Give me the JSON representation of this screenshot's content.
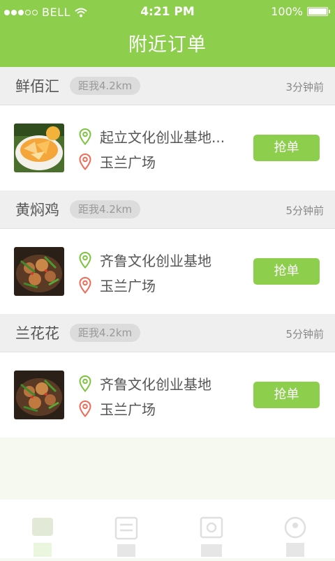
{
  "status_bar": {
    "carrier": "BELL",
    "time": "4:21 PM",
    "battery": "100%"
  },
  "header": {
    "title": "附近订单"
  },
  "orders": [
    {
      "shop": "鲜佰汇",
      "distance": "距我4.2km",
      "time_ago": "3分钟前",
      "from": "起立文化创业基地...",
      "to": "玉兰广场",
      "button": "抢单",
      "thumb": "orange-dessert"
    },
    {
      "shop": "黄焖鸡",
      "distance": "距我4.2km",
      "time_ago": "5分钟前",
      "from": "齐鲁文化创业基地",
      "to": "玉兰广场",
      "button": "抢单",
      "thumb": "braised-chicken"
    },
    {
      "shop": "兰花花",
      "distance": "距我4.2km",
      "time_ago": "5分钟前",
      "from": "齐鲁文化创业基地",
      "to": "玉兰广场",
      "button": "抢单",
      "thumb": "braised-chicken"
    }
  ],
  "colors": {
    "accent": "#8dce4d",
    "pin_from": "#7cc340",
    "pin_to": "#ee6b58",
    "header_text": "#ffffff"
  },
  "tabbar": {
    "icons": [
      "home-icon",
      "list-icon",
      "photo-icon",
      "profile-icon"
    ]
  }
}
